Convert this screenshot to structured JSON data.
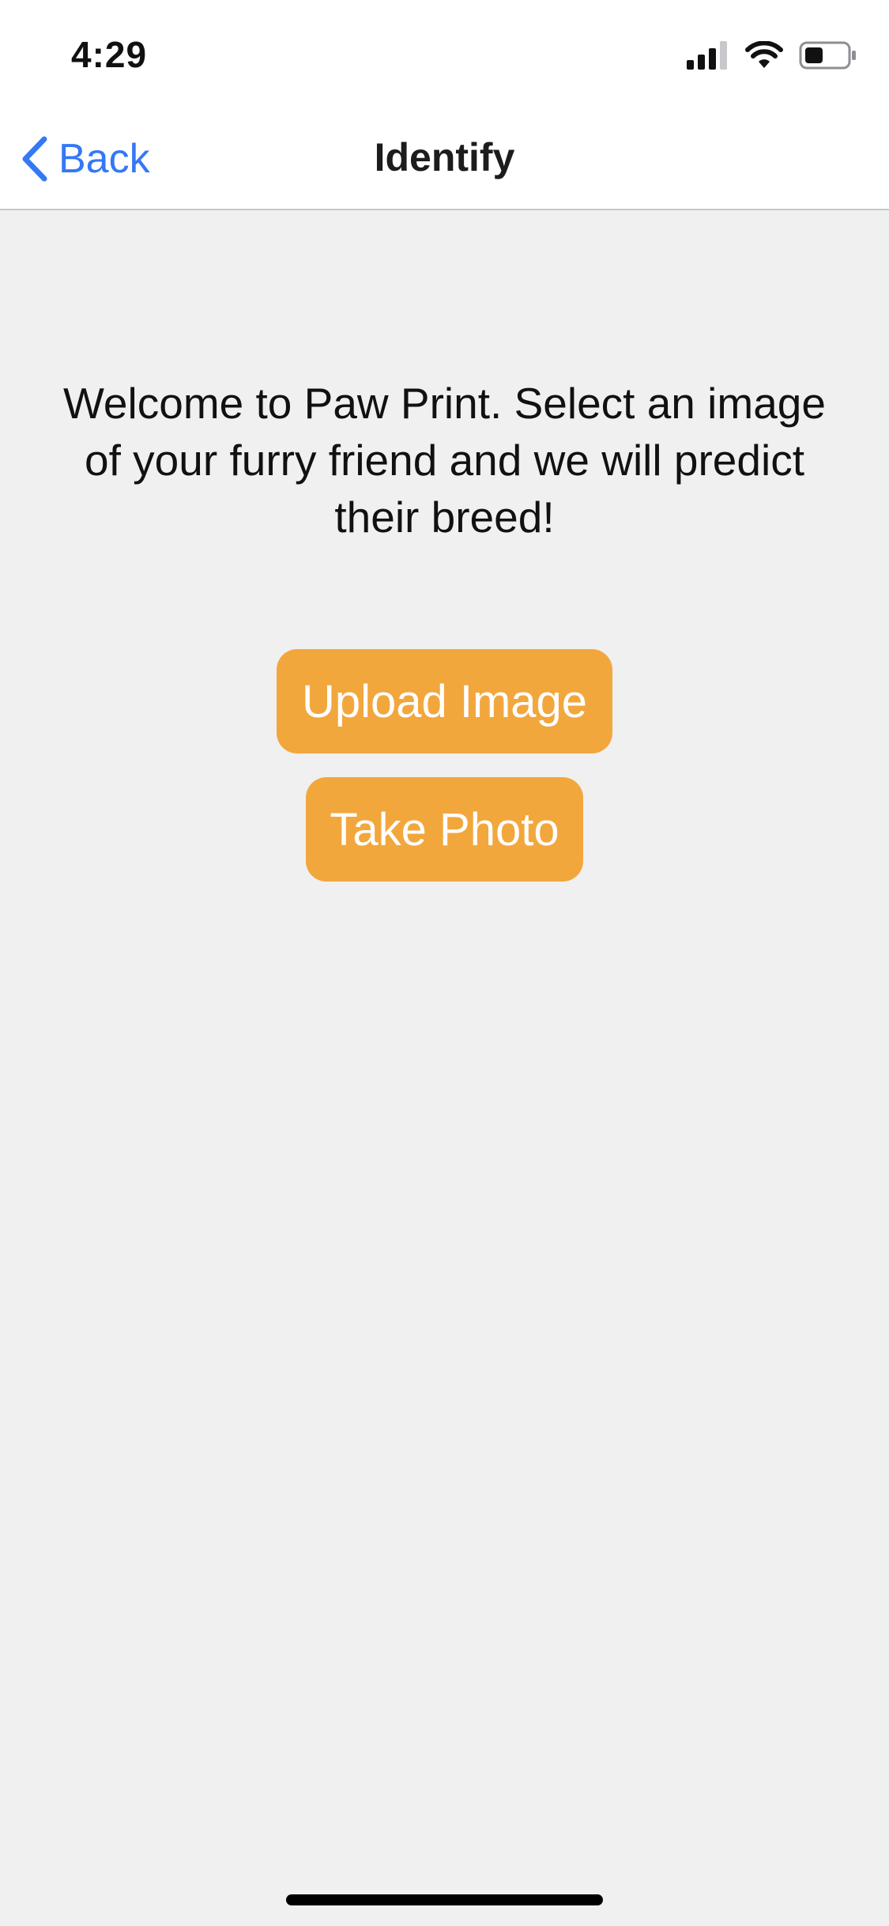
{
  "status_bar": {
    "time": "4:29",
    "icons": [
      "cellular-signal-icon",
      "wifi-icon",
      "battery-icon"
    ]
  },
  "nav": {
    "back_label": "Back",
    "title": "Identify"
  },
  "main": {
    "welcome_text": "Welcome to Paw Print. Select an image of your furry friend and we will predict their breed!",
    "upload_button_label": "Upload Image",
    "take_photo_button_label": "Take Photo"
  },
  "colors": {
    "accent_blue": "#3478f6",
    "button_orange": "#f2a73c",
    "background": "#f0f0f0"
  }
}
